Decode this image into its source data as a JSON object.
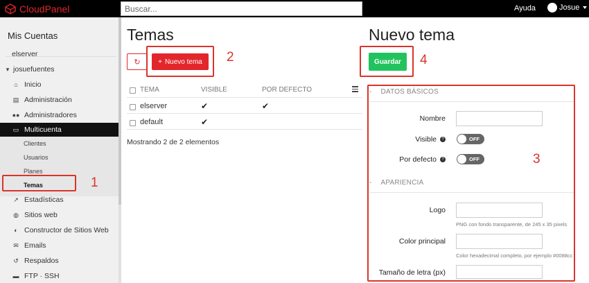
{
  "topbar": {
    "brand": "CloudPanel",
    "search_placeholder": "Buscar...",
    "help": "Ayuda",
    "user": "Josue"
  },
  "sidebar": {
    "title": "Mis Cuentas",
    "items": [
      {
        "label": "elserver"
      },
      {
        "label": "josuefuentes"
      },
      {
        "label": "Inicio",
        "icon": "home-icon"
      },
      {
        "label": "Administración",
        "icon": "document-icon"
      },
      {
        "label": "Administradores",
        "icon": "users-icon"
      },
      {
        "label": "Multicuenta",
        "icon": "monitor-icon",
        "active": true
      },
      {
        "label": "Estadísticas",
        "icon": "trend-icon"
      },
      {
        "label": "Sitios web",
        "icon": "globe-icon"
      },
      {
        "label": "Constructor de Sitios Web",
        "icon": "palette-icon"
      },
      {
        "label": "Emails",
        "icon": "mail-icon"
      },
      {
        "label": "Respaldos",
        "icon": "restore-icon"
      },
      {
        "label": "FTP · SSH",
        "icon": "folder-icon"
      }
    ],
    "subitems": [
      "Clientes",
      "Usuarios",
      "Planes",
      "Temas"
    ]
  },
  "annotations": [
    "1",
    "2",
    "3",
    "4"
  ],
  "themes": {
    "title": "Temas",
    "new_button": "Nuevo tema",
    "columns": [
      "TEMA",
      "VISIBLE",
      "POR DEFECTO"
    ],
    "rows": [
      {
        "name": "elserver",
        "visible": "✔",
        "default": "✔"
      },
      {
        "name": "default",
        "visible": "✔",
        "default": ""
      }
    ],
    "showing": "Mostrando 2 de 2 elementos"
  },
  "new_theme": {
    "title": "Nuevo tema",
    "save_button": "Guardar",
    "section_basic": "DATOS BÁSICOS",
    "section_appearance": "APARIENCIA",
    "collapse": "-",
    "name_label": "Nombre",
    "visible_label": "Visible",
    "default_label": "Por defecto",
    "toggle_off": "OFF",
    "logo_label": "Logo",
    "logo_hint": "PNG con fondo transparente, de 245 x 35 pixels",
    "color_label": "Color principal",
    "color_hint": "Color hexadecimal completo, por ejemplo #0088cc",
    "font_label": "Tamaño de letra (px)"
  },
  "colors": {
    "brand_red": "#e3262b",
    "save_green": "#22c35e",
    "annotation_red": "#d9342b"
  }
}
